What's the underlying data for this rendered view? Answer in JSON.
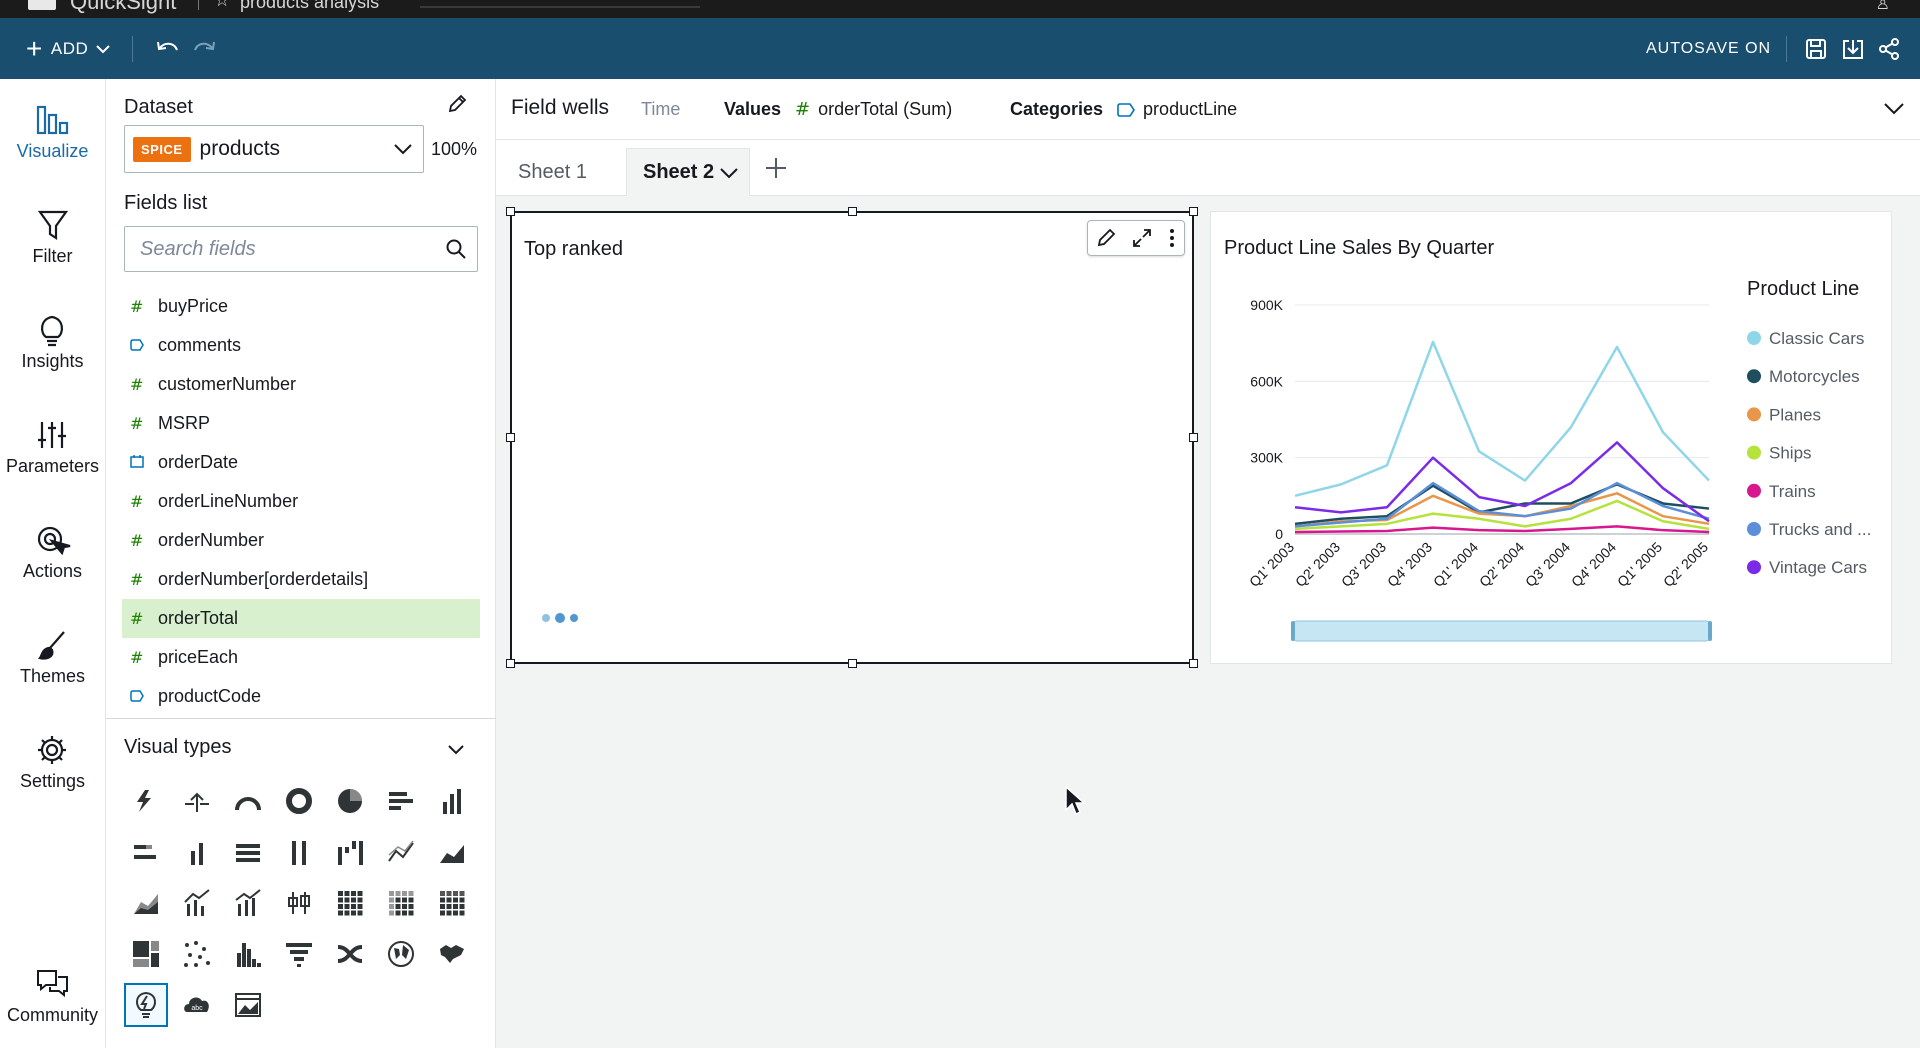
{
  "titlebar": {
    "app_name": "QuickSight",
    "analysis_name": "products analysis"
  },
  "toolbar": {
    "add_label": "ADD",
    "autosave_label": "AUTOSAVE ON"
  },
  "nav": {
    "items": [
      {
        "label": "Visualize",
        "icon": "visualize-icon",
        "active": true
      },
      {
        "label": "Filter",
        "icon": "filter-icon"
      },
      {
        "label": "Insights",
        "icon": "insights-icon"
      },
      {
        "label": "Parameters",
        "icon": "parameters-icon"
      },
      {
        "label": "Actions",
        "icon": "actions-icon"
      },
      {
        "label": "Themes",
        "icon": "themes-icon"
      },
      {
        "label": "Settings",
        "icon": "settings-icon"
      }
    ],
    "community_label": "Community"
  },
  "dataset": {
    "heading": "Dataset",
    "badge": "SPICE",
    "name": "products",
    "spice_usage": "100%"
  },
  "fields": {
    "heading": "Fields list",
    "search_placeholder": "Search fields",
    "items": [
      {
        "name": "buyPrice",
        "type": "measure"
      },
      {
        "name": "comments",
        "type": "dimension"
      },
      {
        "name": "customerNumber",
        "type": "measure"
      },
      {
        "name": "MSRP",
        "type": "measure"
      },
      {
        "name": "orderDate",
        "type": "date"
      },
      {
        "name": "orderLineNumber",
        "type": "measure"
      },
      {
        "name": "orderNumber",
        "type": "measure"
      },
      {
        "name": "orderNumber[orderdetails]",
        "type": "measure"
      },
      {
        "name": "orderTotal",
        "type": "measure",
        "selected": true
      },
      {
        "name": "priceEach",
        "type": "measure"
      },
      {
        "name": "productCode",
        "type": "dimension"
      }
    ]
  },
  "visual_types": {
    "heading": "Visual types"
  },
  "field_wells": {
    "title": "Field wells",
    "time_label": "Time",
    "values_label": "Values",
    "values_field": "orderTotal (Sum)",
    "categories_label": "Categories",
    "categories_field": "productLine"
  },
  "sheets": {
    "tabs": [
      "Sheet 1",
      "Sheet 2"
    ],
    "active": 1
  },
  "visuals": {
    "top_ranked": {
      "title": "Top ranked"
    },
    "line_chart": {
      "title": "Product Line Sales By Quarter"
    }
  },
  "colors": {
    "toolbar": "#1a4e6e",
    "accent": "#0073bb",
    "selected_field": "#d9f0ce",
    "spice": "#ec7211"
  },
  "chart_data": {
    "type": "line",
    "title": "Product Line Sales By Quarter",
    "legend_title": "Product Line",
    "legend_position": "right",
    "x": [
      "Q1' 2003",
      "Q2' 2003",
      "Q3' 2003",
      "Q4' 2003",
      "Q1' 2004",
      "Q2' 2004",
      "Q3' 2004",
      "Q4' 2004",
      "Q1' 2005",
      "Q2' 2005"
    ],
    "y_ticks": [
      "0",
      "300K",
      "600K",
      "900K"
    ],
    "ylim": [
      0,
      900000
    ],
    "grid": true,
    "series": [
      {
        "name": "Classic Cars",
        "color": "#8fd6e8",
        "values": [
          150000,
          195000,
          270000,
          755000,
          325000,
          210000,
          420000,
          735000,
          400000,
          210000
        ]
      },
      {
        "name": "Motorcycles",
        "color": "#1f4e5f",
        "values": [
          40000,
          60000,
          70000,
          190000,
          85000,
          120000,
          120000,
          195000,
          120000,
          100000
        ]
      },
      {
        "name": "Planes",
        "color": "#e8964a",
        "values": [
          30000,
          50000,
          55000,
          150000,
          80000,
          70000,
          110000,
          160000,
          70000,
          40000
        ]
      },
      {
        "name": "Ships",
        "color": "#b5e23b",
        "values": [
          20000,
          30000,
          40000,
          80000,
          60000,
          30000,
          60000,
          130000,
          50000,
          20000
        ]
      },
      {
        "name": "Trains",
        "color": "#d8178f",
        "values": [
          8000,
          10000,
          12000,
          25000,
          15000,
          12000,
          20000,
          30000,
          15000,
          8000
        ]
      },
      {
        "name": "Trucks and ...",
        "color": "#5b8fd9",
        "values": [
          30000,
          45000,
          60000,
          200000,
          90000,
          70000,
          100000,
          200000,
          110000,
          60000
        ]
      },
      {
        "name": "Vintage Cars",
        "color": "#7b2be8",
        "values": [
          105000,
          85000,
          105000,
          300000,
          145000,
          110000,
          200000,
          360000,
          180000,
          50000
        ]
      }
    ]
  }
}
